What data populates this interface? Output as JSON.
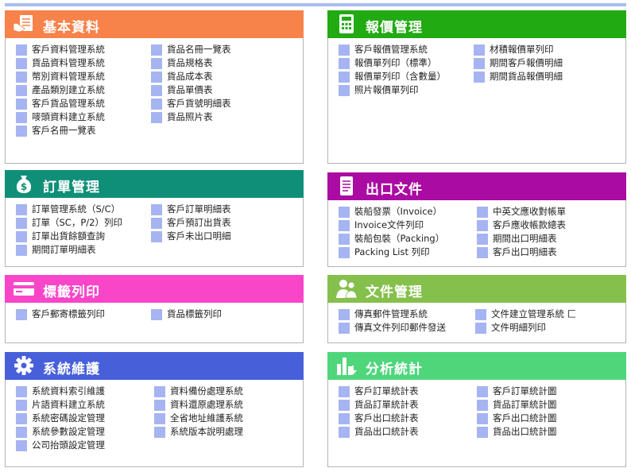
{
  "panels": {
    "basic": {
      "title": "基本資料",
      "color": "#f7834a",
      "icon": "document-hand-icon",
      "col1": [
        "客戶資料管理系統",
        "貨品資料管理系統",
        "幣別資料管理系統",
        "產品類別建立系統",
        "客戶貨品管理系統",
        "嘜頭資料建立系統",
        "客戶名冊一覽表"
      ],
      "col2": [
        "貨品名冊一覽表",
        "貨品規格表",
        "貨品成本表",
        "貨品單價表",
        "客戶貨號明細表",
        "貨品照片表"
      ]
    },
    "quote": {
      "title": "報價管理",
      "color": "#21aa12",
      "icon": "calculator-icon",
      "col1": [
        "客戶報價管理系統",
        "報價單列印（標準）",
        "報價單列印（含數量）",
        "照片報價單列印"
      ],
      "col2": [
        "材積報價單列印",
        "期間客戶報價明細",
        "期間貨品報價明細"
      ]
    },
    "order": {
      "title": "訂單管理",
      "color": "#0f8f78",
      "icon": "money-bag-icon",
      "col1": [
        "訂單管理系統（S/C）",
        "訂單（SC，P/2）列印",
        "訂單出貨餘額查詢",
        "期間訂單明細表"
      ],
      "col2": [
        "客戶訂單明細表",
        "客戶預訂出貨表",
        "客戶未出口明細"
      ]
    },
    "export": {
      "title": "出口文件",
      "color": "#aa0ba2",
      "icon": "notepad-icon",
      "col1": [
        "裝船發票（Invoice）",
        "Invoice文件列印",
        "裝船包裝（Packing）",
        "Packing List 列印"
      ],
      "col2": [
        "中英文應收對帳單",
        "客戶應收帳款總表",
        "期間出口明細表",
        "客戶出口明細表"
      ]
    },
    "label": {
      "title": "標籤列印",
      "color": "#f945c8",
      "icon": "credit-card-icon",
      "col1": [
        "客戶郵寄標籤列印"
      ],
      "col2": [
        "貨品標籤列印"
      ]
    },
    "docs": {
      "title": "文件管理",
      "color": "#85c04c",
      "icon": "users-icon",
      "col1": [
        "傳真郵件管理系統",
        "傳真文件列印郵件發送"
      ],
      "col2": [
        "文件建立管理系統 匚",
        "文件明細列印"
      ]
    },
    "system": {
      "title": "系統維護",
      "color": "#4760da",
      "icon": "gear-icon",
      "col1": [
        "系統資料索引維護",
        "片語資料建立系統",
        "系統密碼設定管理",
        "系統參數設定管理",
        "公司抬頭設定管理"
      ],
      "col2": [
        "資料備份處理系統",
        "資料還原處理系統",
        "全省地址維護系統",
        "系統版本說明處理"
      ]
    },
    "stats": {
      "title": "分析統計",
      "color": "#4fd67b",
      "icon": "bar-chart-icon",
      "col1": [
        "客戶訂單統計表",
        "貨品訂單統計表",
        "客戶出口統計表",
        "貨品出口統計表"
      ],
      "col2": [
        "客戶訂單統計圖",
        "貨品訂單統計圖",
        "客戶出口統計圖",
        "貨品出口統計圖"
      ]
    }
  }
}
